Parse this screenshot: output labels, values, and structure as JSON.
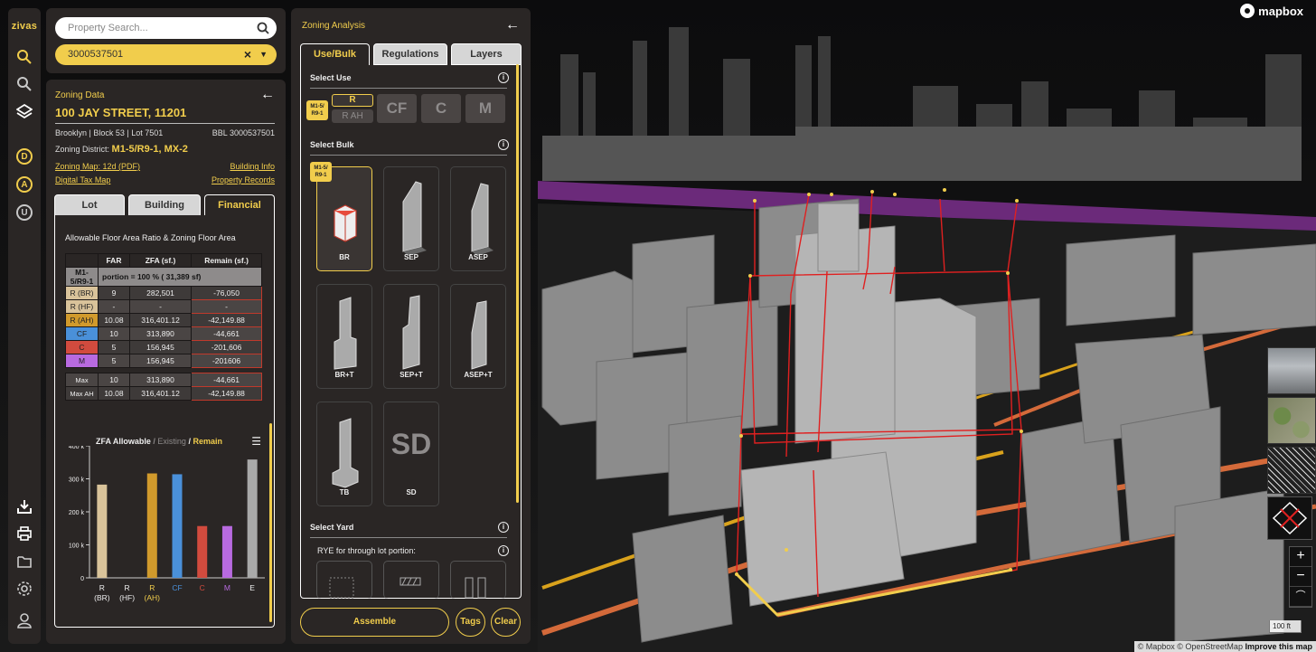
{
  "map": {
    "logo": "mapbox",
    "attribution": "© Mapbox © OpenStreetMap",
    "improve": "Improve this map",
    "scale_label": "100 ft",
    "zoom_in": "+",
    "zoom_out": "−"
  },
  "rail": {
    "brand": "zivas",
    "circle_buttons": [
      "D",
      "A",
      "U"
    ]
  },
  "search": {
    "placeholder": "Property Search...",
    "selected": "3000537501",
    "clear": "×"
  },
  "zoning_data": {
    "header": "Zoning Data",
    "address": "100 JAY STREET, 11201",
    "location": "Brooklyn | Block 53 | Lot 7501",
    "bbl": "BBL 3000537501",
    "district_label": "Zoning District:",
    "district": "M1-5/R9-1, MX-2",
    "links": {
      "zoning_map": "Zoning Map: 12d (PDF)",
      "building_info": "Building Info",
      "digital_tax_map": "Digital Tax Map",
      "property_records": "Property Records"
    },
    "tabs": [
      "Lot",
      "Building",
      "Financial"
    ],
    "active_tab": "Financial",
    "table_title": "Allowable Floor Area Ratio & Zoning Floor Area",
    "columns": [
      "",
      "FAR",
      "ZFA (sf.)",
      "Remain (sf.)"
    ],
    "portion_district": "M1-5/R9-1",
    "portion_text": "portion = 100 % ( 31,389 sf)",
    "rows": [
      {
        "label": "R (BR)",
        "far": "9",
        "zfa": "282,501",
        "remain": "-76,050",
        "color": "#d9c39a"
      },
      {
        "label": "R (HF)",
        "far": "-",
        "zfa": "-",
        "remain": "-",
        "color": "#d9c39a"
      },
      {
        "label": "R (AH)",
        "far": "10.08",
        "zfa": "316,401.12",
        "remain": "-42,149.88",
        "color": "#d19a2c"
      },
      {
        "label": "CF",
        "far": "10",
        "zfa": "313,890",
        "remain": "-44,661",
        "color": "#4a90d9"
      },
      {
        "label": "C",
        "far": "5",
        "zfa": "156,945",
        "remain": "-201,606",
        "color": "#d24b3e"
      },
      {
        "label": "M",
        "far": "5",
        "zfa": "156,945",
        "remain": "-201606",
        "color": "#b86ae0"
      }
    ],
    "max_rows": [
      {
        "label": "Max",
        "far": "10",
        "zfa": "313,890",
        "remain": "-44,661"
      },
      {
        "label": "Max AH",
        "far": "10.08",
        "zfa": "316,401.12",
        "remain": "-42,149.88"
      }
    ],
    "chart_title_a": "ZFA Allowable",
    "chart_title_b": "Existing",
    "chart_title_c": "Remain",
    "chart_sep": "/"
  },
  "chart_data": {
    "type": "bar",
    "title": "ZFA Allowable / Existing / Remain",
    "categories": [
      "R (BR)",
      "R (HF)",
      "R (AH)",
      "CF",
      "C",
      "M",
      "E"
    ],
    "category_lines": [
      [
        "R",
        "(BR)"
      ],
      [
        "R",
        "(HF)"
      ],
      [
        "R",
        "(AH)"
      ],
      [
        "CF"
      ],
      [
        "C"
      ],
      [
        "M"
      ],
      [
        "E"
      ]
    ],
    "values": [
      282501,
      0,
      316401,
      313890,
      156945,
      156945,
      358551
    ],
    "colors": [
      "#d9c39a",
      "#d9c39a",
      "#d19a2c",
      "#4a90d9",
      "#d24b3e",
      "#b86ae0",
      "#a9a9a9"
    ],
    "label_colors": [
      "#eee",
      "#eee",
      "#f1cd4c",
      "#4a90d9",
      "#d24b3e",
      "#b86ae0",
      "#eee"
    ],
    "yticks": [
      0,
      100000,
      200000,
      300000,
      400000
    ],
    "ytick_labels": [
      "0",
      "100 k",
      "200 k",
      "300 k",
      "400 k"
    ],
    "ylim": [
      0,
      400000
    ],
    "grid": false
  },
  "zoning_analysis": {
    "header": "Zoning Analysis",
    "tabs": [
      "Use/Bulk",
      "Regulations",
      "Layers"
    ],
    "active_tab": "Use/Bulk",
    "select_use": "Select Use",
    "zone_tag": [
      "M1-5/",
      "R9-1"
    ],
    "use_r": "R",
    "use_rah": "R AH",
    "use_buttons": [
      "CF",
      "C",
      "M"
    ],
    "select_bulk": "Select Bulk",
    "bulk_options": [
      "BR",
      "SEP",
      "ASEP",
      "BR+T",
      "SEP+T",
      "ASEP+T",
      "TB",
      "SD"
    ],
    "selected_bulk": "BR",
    "sd_glyph": "SD",
    "select_yard": "Select Yard",
    "rye_label": "RYE for through lot portion:",
    "info_glyph": "i",
    "footer": {
      "assemble": "Assemble",
      "tags": "Tags",
      "clear": "Clear"
    }
  }
}
